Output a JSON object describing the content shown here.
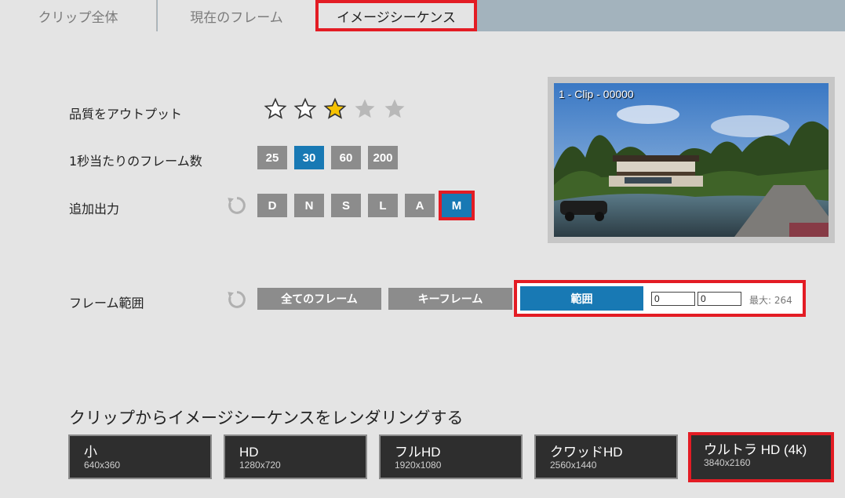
{
  "tabs": {
    "clip": "クリップ全体",
    "frame": "現在のフレーム",
    "sequence": "イメージシーケンス"
  },
  "quality": {
    "label": "品質をアウトプット",
    "selected": 3,
    "max": 5
  },
  "fps": {
    "label": "1秒当たりのフレーム数",
    "options": [
      "25",
      "30",
      "60",
      "200"
    ],
    "selected": "30"
  },
  "extra": {
    "label": "追加出力",
    "options": [
      "D",
      "N",
      "S",
      "L",
      "A",
      "M"
    ],
    "selected": "M"
  },
  "range": {
    "label": "フレーム範囲",
    "all_label": "全てのフレーム",
    "key_label": "キーフレーム",
    "range_label": "範囲",
    "from": "0",
    "to": "0",
    "max_label": "最大: 264"
  },
  "preview": {
    "caption": "1 - Clip - 00000"
  },
  "render": {
    "title": "クリップからイメージシーケンスをレンダリングする",
    "sizes": [
      {
        "name": "小",
        "res": "640x360"
      },
      {
        "name": "HD",
        "res": "1280x720"
      },
      {
        "name": "フルHD",
        "res": "1920x1080"
      },
      {
        "name": "クワッドHD",
        "res": "2560x1440"
      },
      {
        "name": "ウルトラ HD (4k)",
        "res": "3840x2160"
      }
    ]
  },
  "colors": {
    "accent": "#1879b4",
    "highlight": "#e31c24",
    "star_active": "#f6c200"
  }
}
